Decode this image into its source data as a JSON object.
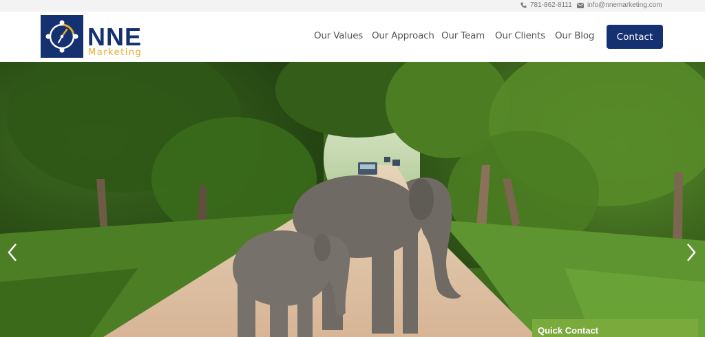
{
  "topbar": {
    "phone": "781-862-8111",
    "email": "info@nnemarketing.com",
    "phone_icon": "phone-icon",
    "email_icon": "envelope-icon"
  },
  "logo": {
    "name": "NNE",
    "subtitle": "Marketing",
    "icon": "compass-icon"
  },
  "nav": {
    "items": [
      "Our Values",
      "Our Approach",
      "Our Team",
      "Our Clients",
      "Our Blog"
    ],
    "contact_label": "Contact"
  },
  "hero": {
    "prev_icon": "chevron-left-icon",
    "next_icon": "chevron-right-icon",
    "quick_contact": "Quick Contact"
  },
  "colors": {
    "navy": "#163171",
    "gold": "#e9ad2c",
    "green": "#7aa93c",
    "topbar": "#f3f3f3"
  }
}
